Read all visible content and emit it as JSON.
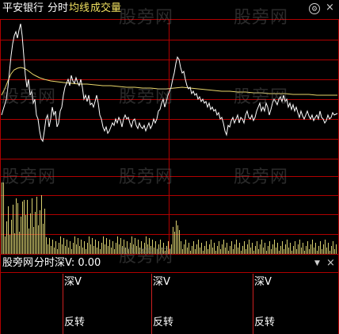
{
  "header": {
    "stock_name": "平安银行",
    "mode": "分时",
    "avg_label": "均线",
    "volume_label": "成交量"
  },
  "toolbar": {
    "settings_glyph": "⚙",
    "close_glyph": "×"
  },
  "sub_header": {
    "title": "股旁网",
    "indicator": "分时深V: 0.00",
    "dropdown_glyph": "▼",
    "close_glyph": "×"
  },
  "signals": [
    {
      "id": "a",
      "top_label": "深V",
      "bottom_label": "反转"
    },
    {
      "id": "b",
      "top_label": "深V",
      "bottom_label": "反转"
    },
    {
      "id": "c",
      "top_label": "深V",
      "bottom_label": "反转"
    }
  ],
  "watermark": "股旁网",
  "colors": {
    "background": "#000000",
    "grid_red": "#b00000",
    "price_line": "#ffffff",
    "avg_line": "#e8d66a",
    "volume_bar": "#d8d070",
    "signal_line": "#cc2020",
    "label_white": "#ffffff",
    "label_yellow": "#f0e060",
    "label_red": "#ff4040"
  }
}
